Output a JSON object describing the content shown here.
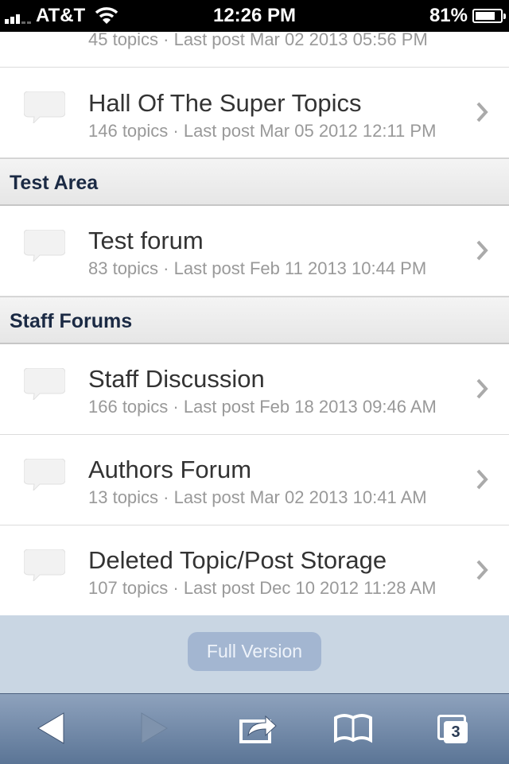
{
  "status_bar": {
    "carrier": "AT&T",
    "time": "12:26 PM",
    "battery": "81%",
    "battery_level": 0.81
  },
  "top_partial": {
    "meta": "45 topics · Last post Mar 02 2013 05:56 PM"
  },
  "forums_1": [
    {
      "title": "Hall Of The Super Topics",
      "meta": "146 topics · Last post Mar 05 2012 12:11 PM"
    }
  ],
  "sections": [
    {
      "name": "Test Area",
      "forums": [
        {
          "title": "Test forum",
          "meta": "83 topics · Last post Feb 11 2013 10:44 PM"
        }
      ]
    },
    {
      "name": "Staff Forums",
      "forums": [
        {
          "title": "Staff Discussion",
          "meta": "166 topics · Last post Feb 18 2013 09:46 AM"
        },
        {
          "title": "Authors Forum",
          "meta": "13 topics · Last post Mar 02 2013 10:41 AM"
        },
        {
          "title": "Deleted Topic/Post Storage",
          "meta": "107 topics · Last post Dec 10 2012 11:28 AM"
        }
      ]
    }
  ],
  "footer": {
    "full_version_label": "Full Version"
  },
  "toolbar": {
    "tab_count": "3"
  }
}
